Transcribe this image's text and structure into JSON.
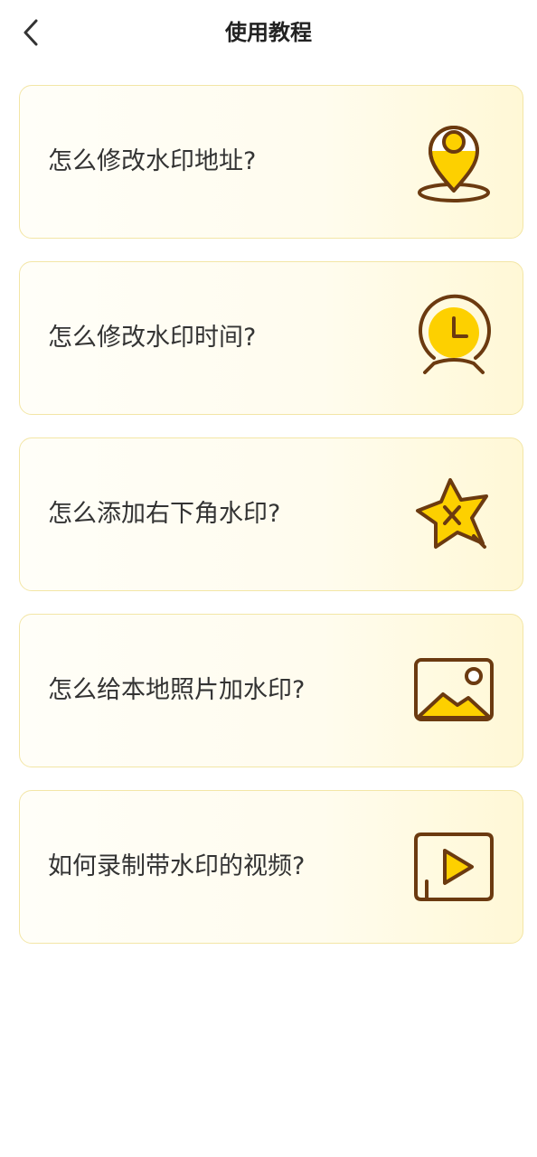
{
  "header": {
    "title": "使用教程",
    "back_icon": "chevron-left-icon"
  },
  "colors": {
    "accent": "#FDD000",
    "icon_stroke": "#6B3A10",
    "card_border": "#F3E6A6"
  },
  "tutorials": [
    {
      "label": "怎么修改水印地址?",
      "icon": "location-pin-icon"
    },
    {
      "label": "怎么修改水印时间?",
      "icon": "alarm-clock-icon"
    },
    {
      "label": "怎么添加右下角水印?",
      "icon": "star-icon"
    },
    {
      "label": "怎么给本地照片加水印?",
      "icon": "image-icon"
    },
    {
      "label": "如何录制带水印的视频?",
      "icon": "video-play-icon"
    }
  ]
}
